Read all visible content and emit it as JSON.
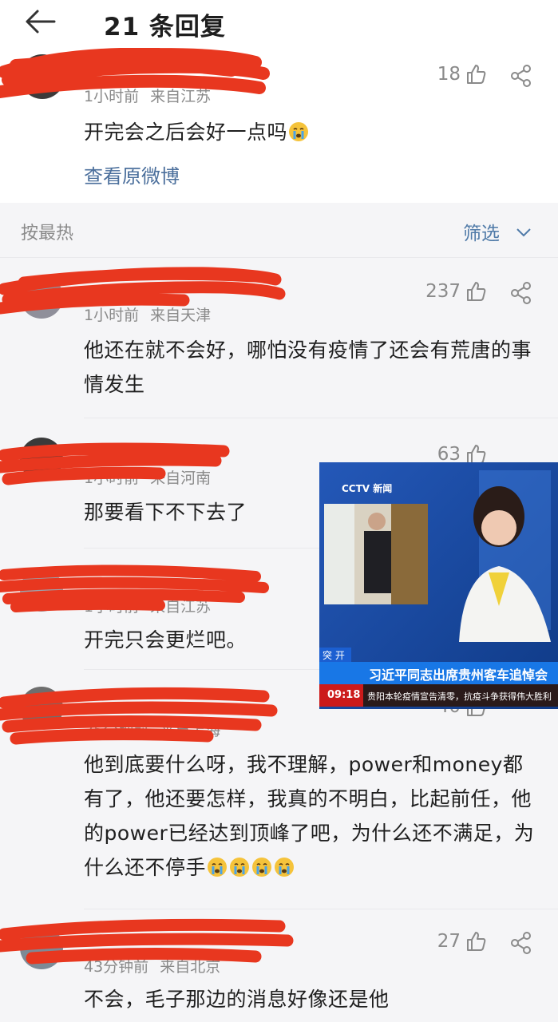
{
  "header": {
    "back_icon": "back-arrow-icon",
    "title": "21 条回复"
  },
  "root_comment": {
    "meta_time": "1小时前",
    "meta_source": "来自江苏",
    "likes": "18",
    "text": "开完会之后会好一点吗",
    "emoji": "crying-face-emoji",
    "view_original": "查看原微博"
  },
  "sort_bar": {
    "sort_label": "按最热",
    "filter_label": "筛选"
  },
  "comments": [
    {
      "meta_time": "1小时前",
      "meta_source": "来自天津",
      "likes": "237",
      "text": "他还在就不会好，哪怕没有疫情了还会有荒唐的事情发生"
    },
    {
      "meta_time": "1小时前",
      "meta_source": "来自河南",
      "likes": "63",
      "text": "那要看下不下去了"
    },
    {
      "meta_time": "1小时前",
      "meta_source": "来自江苏",
      "likes": "",
      "text": "开完只会更烂吧。"
    },
    {
      "meta_time": "35分钟前",
      "meta_source": "来自上海",
      "likes": "40",
      "text": "他到底要什么呀，我不理解，power和money都有了，他还要怎样，我真的不明白，比起前任，他的power已经达到顶峰了吧，为什么还不满足，为什么还不停手"
    },
    {
      "meta_time": "43分钟前",
      "meta_source": "来自北京",
      "likes": "27",
      "text": "不会，毛子那边的消息好像还是他"
    }
  ],
  "news_image": {
    "logo": "CCTV 新闻",
    "tag": "突 开",
    "headline": "习近平同志出席贵州客车追悼会",
    "time": "09:18",
    "ticker": "贵阳本轮疫情宣告清零，抗疫斗争获得伟大胜利"
  },
  "colors": {
    "link": "#4b6f9c",
    "scribble": "#e8371f",
    "gray_bg": "#f5f5f7",
    "news_blue": "#1a4fa2"
  }
}
